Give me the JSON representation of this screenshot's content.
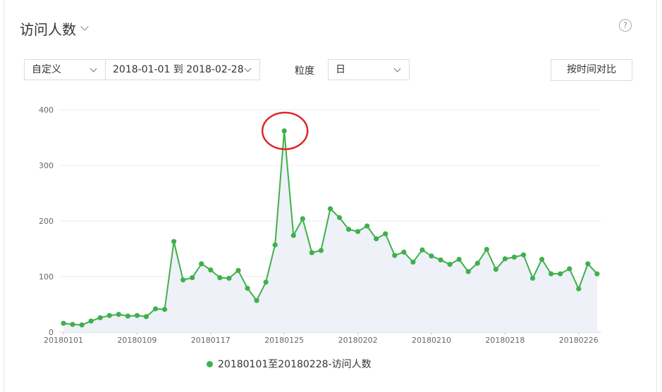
{
  "header": {
    "title": "访问人数",
    "help_icon": "?"
  },
  "controls": {
    "range_type": "自定义",
    "date_range": "2018-01-01 到 2018-02-28",
    "granularity_label": "粒度",
    "granularity_value": "日",
    "compare_button": "按时间对比"
  },
  "colors": {
    "series": "#3fb04b",
    "area": "#eef1f7",
    "highlight": "#e0262b"
  },
  "chart_data": {
    "type": "line",
    "x_tick_labels": [
      "20180101",
      "20180109",
      "20180117",
      "20180125",
      "20180202",
      "20180210",
      "20180218",
      "20180226"
    ],
    "y_ticks": [
      0,
      100,
      200,
      300,
      400
    ],
    "ylim": [
      0,
      400
    ],
    "grid": true,
    "legend_position": "bottom",
    "series": [
      {
        "name": "20180101至20180228-访问人数",
        "values": [
          16,
          14,
          13,
          20,
          26,
          30,
          32,
          29,
          30,
          28,
          42,
          41,
          163,
          94,
          98,
          123,
          112,
          98,
          97,
          111,
          79,
          57,
          90,
          157,
          362,
          174,
          204,
          143,
          147,
          222,
          206,
          185,
          181,
          191,
          168,
          177,
          138,
          144,
          126,
          148,
          137,
          130,
          122,
          131,
          109,
          124,
          149,
          113,
          132,
          135,
          139,
          97,
          131,
          105,
          105,
          114,
          78,
          123,
          105
        ]
      }
    ],
    "annotation": {
      "type": "circle",
      "target_index": 24
    }
  }
}
